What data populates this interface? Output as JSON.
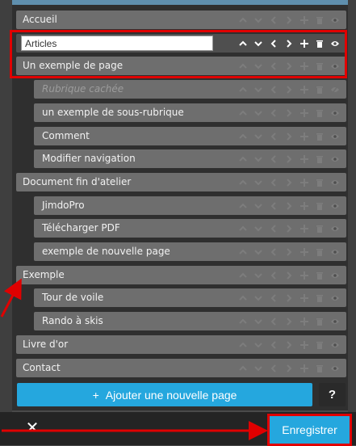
{
  "pages": [
    {
      "label": "Accueil",
      "level": 0,
      "state": "normal"
    },
    {
      "label": "Articles",
      "level": 0,
      "state": "editing"
    },
    {
      "label": "Un exemple de page",
      "level": 0,
      "state": "normal"
    },
    {
      "label": "Rubrique cachée",
      "level": 1,
      "state": "hidden"
    },
    {
      "label": "un exemple de sous-rubrique",
      "level": 1,
      "state": "normal"
    },
    {
      "label": "Comment",
      "level": 1,
      "state": "normal"
    },
    {
      "label": "Modifier navigation",
      "level": 1,
      "state": "normal"
    },
    {
      "label": "Document fin d'atelier",
      "level": 0,
      "state": "normal"
    },
    {
      "label": "JimdoPro",
      "level": 1,
      "state": "normal"
    },
    {
      "label": "Télécharger PDF",
      "level": 1,
      "state": "normal"
    },
    {
      "label": "exemple de nouvelle page",
      "level": 1,
      "state": "normal"
    },
    {
      "label": "Exemple",
      "level": 0,
      "state": "normal"
    },
    {
      "label": "Tour de voile",
      "level": 1,
      "state": "normal"
    },
    {
      "label": "Rando à skis",
      "level": 1,
      "state": "normal"
    },
    {
      "label": "Livre d'or",
      "level": 0,
      "state": "normal"
    },
    {
      "label": "Contact",
      "level": 0,
      "state": "normal"
    }
  ],
  "row_icons": [
    "chevron-up-icon",
    "chevron-down-icon",
    "chevron-left-icon",
    "chevron-right-icon",
    "plus-icon",
    "trash-icon",
    "eye-icon"
  ],
  "add_page_label": "Ajouter une nouvelle page",
  "help_label": "?",
  "close_label": "✕",
  "save_label": "Enregistrer",
  "colors": {
    "accent": "#25a7de",
    "row": "#6e6e6e",
    "panel": "#2f2f2f",
    "annotation": "#e00000"
  }
}
